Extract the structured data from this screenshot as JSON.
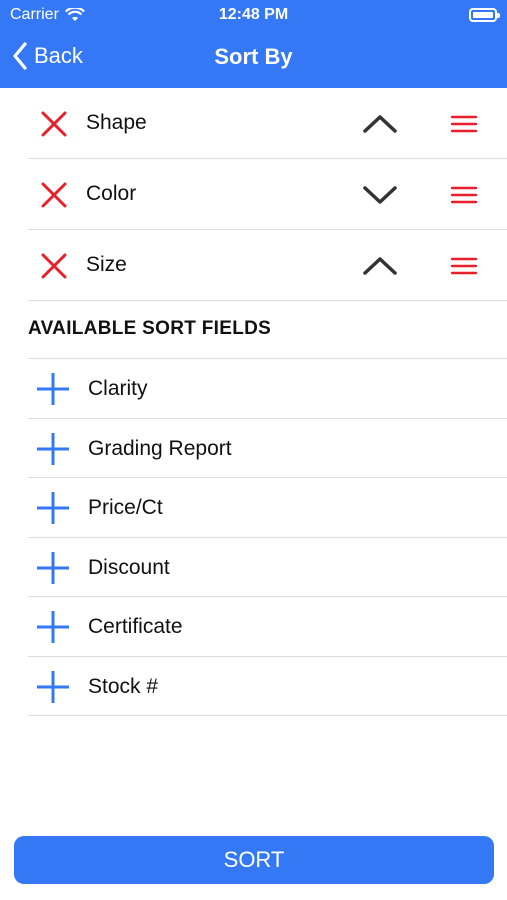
{
  "status_bar": {
    "carrier": "Carrier",
    "time": "12:48 PM"
  },
  "nav": {
    "back_label": "Back",
    "title": "Sort By"
  },
  "sorted_fields": [
    {
      "label": "Shape",
      "direction": "ascending"
    },
    {
      "label": "Color",
      "direction": "descending"
    },
    {
      "label": "Size",
      "direction": "ascending"
    }
  ],
  "available_title": "AVAILABLE SORT FIELDS",
  "available_fields": [
    {
      "label": "Clarity"
    },
    {
      "label": "Grading Report"
    },
    {
      "label": "Price/Ct"
    },
    {
      "label": "Discount"
    },
    {
      "label": "Certificate"
    },
    {
      "label": "Stock #"
    }
  ],
  "sort_button_label": "SORT",
  "colors": {
    "accent": "#3478f6",
    "remove": "#e8202a",
    "chevron": "#333333"
  },
  "icons": {
    "remove": "x-icon",
    "ascending": "chevron-up-icon",
    "descending": "chevron-down-icon",
    "drag": "hamburger-icon",
    "add": "plus-icon"
  }
}
